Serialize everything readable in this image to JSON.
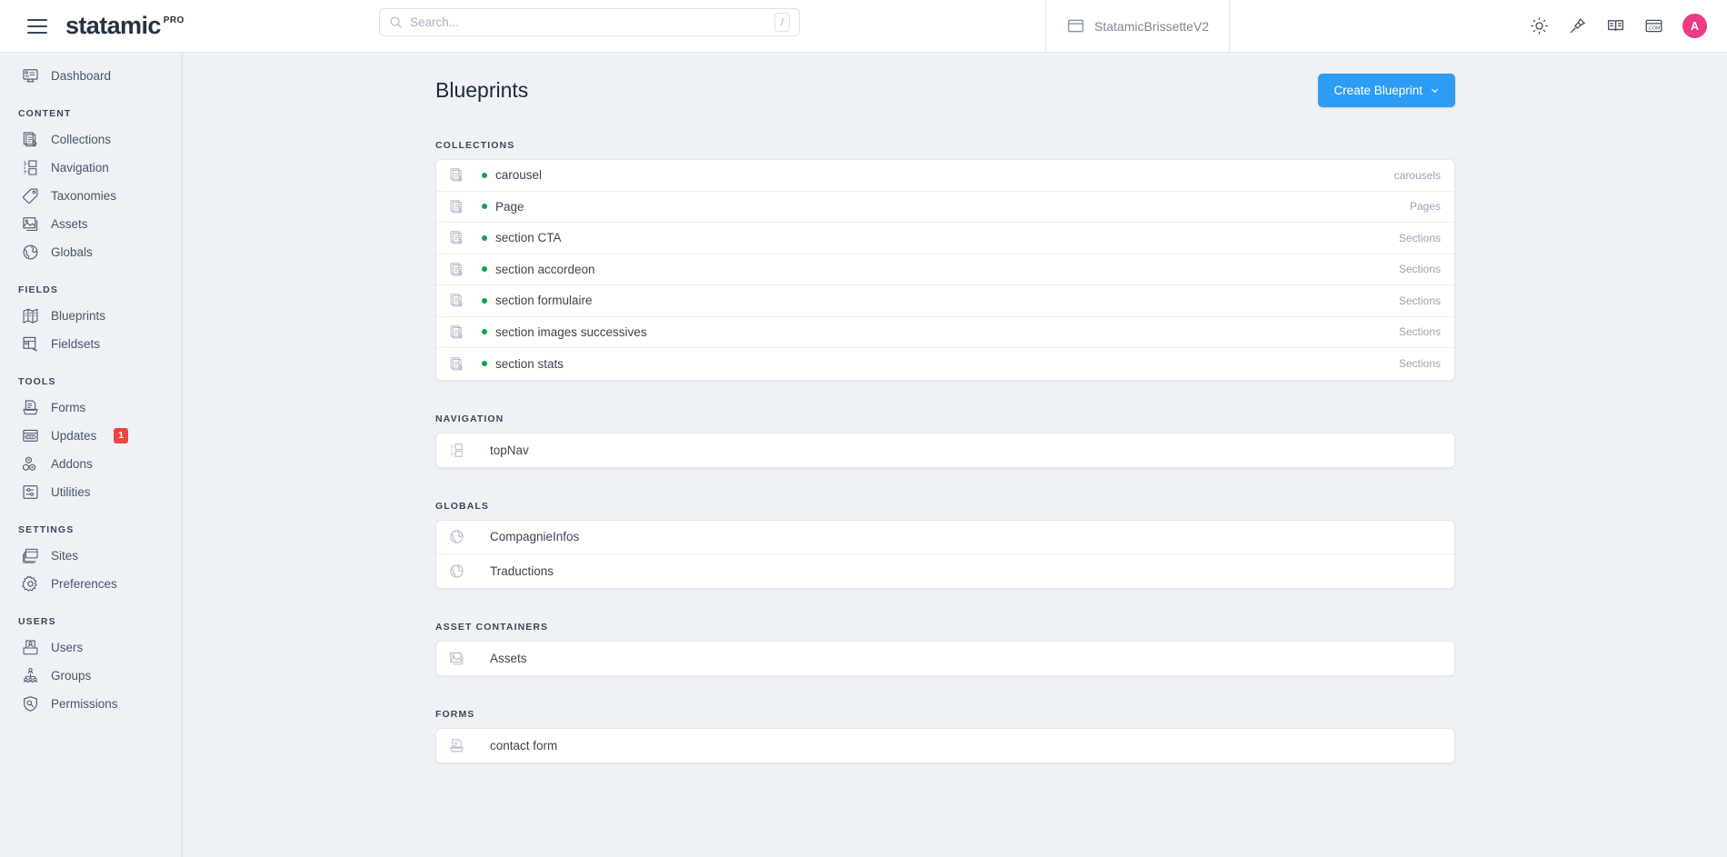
{
  "topbar": {
    "menu_icon": "hamburger-icon",
    "brand": "statamic",
    "brand_sup": "PRO",
    "search": {
      "placeholder": "Search...",
      "value": "",
      "icon": "search-icon",
      "shortcut": "/"
    },
    "site": {
      "label": "StatamicBrissetteV2",
      "icon": "browser-window-icon"
    },
    "actions": [
      {
        "name": "theme-toggle-icon",
        "label": "sun-icon"
      },
      {
        "name": "pin-icon",
        "label": "pin-icon"
      },
      {
        "name": "docs-icon",
        "label": "book-icon"
      },
      {
        "name": "site-link-icon",
        "label": "dot-com-icon"
      }
    ],
    "avatar": {
      "initial": "A",
      "color": "#ec3b83"
    }
  },
  "sidebar": {
    "top": [
      {
        "label": "Dashboard",
        "icon": "dashboard-icon"
      }
    ],
    "groups": [
      {
        "title": "CONTENT",
        "items": [
          {
            "label": "Collections",
            "icon": "collections-icon"
          },
          {
            "label": "Navigation",
            "icon": "navigation-icon"
          },
          {
            "label": "Taxonomies",
            "icon": "taxonomies-icon"
          },
          {
            "label": "Assets",
            "icon": "assets-icon"
          },
          {
            "label": "Globals",
            "icon": "globals-icon"
          }
        ]
      },
      {
        "title": "FIELDS",
        "items": [
          {
            "label": "Blueprints",
            "icon": "blueprints-icon"
          },
          {
            "label": "Fieldsets",
            "icon": "fieldsets-icon"
          }
        ]
      },
      {
        "title": "TOOLS",
        "items": [
          {
            "label": "Forms",
            "icon": "forms-icon"
          },
          {
            "label": "Updates",
            "icon": "updates-icon",
            "badge": "1"
          },
          {
            "label": "Addons",
            "icon": "addons-icon"
          },
          {
            "label": "Utilities",
            "icon": "utilities-icon"
          }
        ]
      },
      {
        "title": "SETTINGS",
        "items": [
          {
            "label": "Sites",
            "icon": "sites-icon"
          },
          {
            "label": "Preferences",
            "icon": "gear-icon"
          }
        ]
      },
      {
        "title": "USERS",
        "items": [
          {
            "label": "Users",
            "icon": "users-icon"
          },
          {
            "label": "Groups",
            "icon": "groups-icon"
          },
          {
            "label": "Permissions",
            "icon": "shield-icon"
          }
        ]
      }
    ]
  },
  "page": {
    "title": "Blueprints",
    "create_button": "Create Blueprint",
    "create_button_chevron": "chevron-down-icon"
  },
  "sections": [
    {
      "title": "COLLECTIONS",
      "icon": "blueprint-file-icon",
      "dots": true,
      "rows": [
        {
          "label": "carousel",
          "meta": "carousels"
        },
        {
          "label": "Page",
          "meta": "Pages"
        },
        {
          "label": "section CTA",
          "meta": "Sections"
        },
        {
          "label": "section accordeon",
          "meta": "Sections"
        },
        {
          "label": "section formulaire",
          "meta": "Sections"
        },
        {
          "label": "section images successives",
          "meta": "Sections"
        },
        {
          "label": "section stats",
          "meta": "Sections"
        }
      ]
    },
    {
      "title": "NAVIGATION",
      "icon": "navigation-icon",
      "dots": false,
      "rows": [
        {
          "label": "topNav",
          "meta": ""
        }
      ]
    },
    {
      "title": "GLOBALS",
      "icon": "globals-icon",
      "dots": false,
      "rows": [
        {
          "label": "CompagnieInfos",
          "meta": ""
        },
        {
          "label": "Traductions",
          "meta": ""
        }
      ]
    },
    {
      "title": "ASSET CONTAINERS",
      "icon": "assets-icon",
      "dots": false,
      "rows": [
        {
          "label": "Assets",
          "meta": ""
        }
      ]
    },
    {
      "title": "FORMS",
      "icon": "forms-icon",
      "dots": false,
      "rows": [
        {
          "label": "contact form",
          "meta": ""
        }
      ]
    }
  ],
  "colors": {
    "accent": "#2c9cf4",
    "avatar": "#ec3b83",
    "status_dot": "#16a34a",
    "badge": "#ef4444",
    "page_bg": "#eef1f6"
  }
}
